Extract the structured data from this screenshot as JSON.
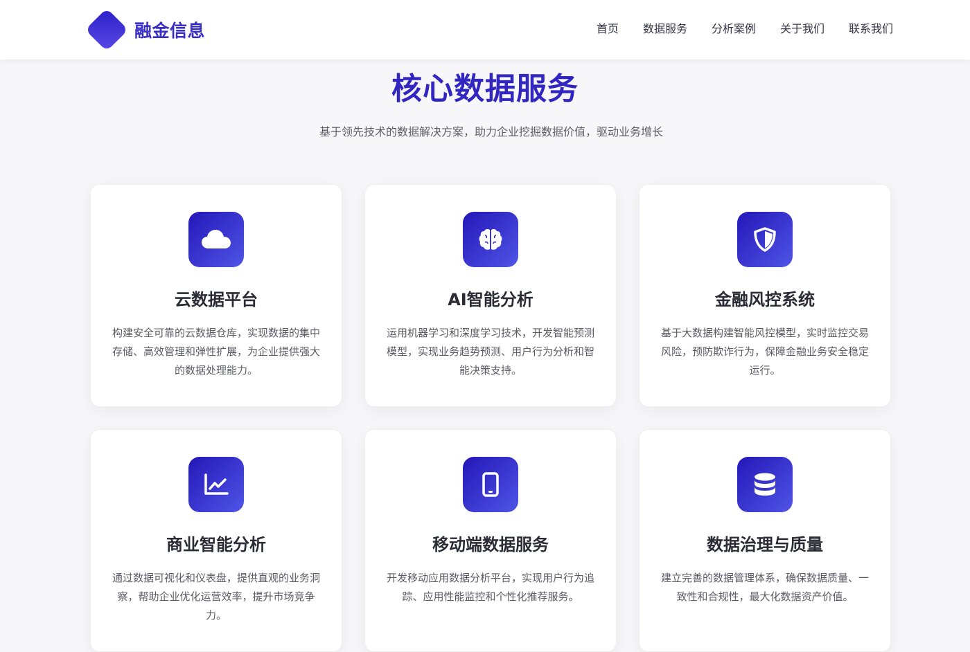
{
  "brand": {
    "name": "融金信息"
  },
  "nav": [
    {
      "label": "首页"
    },
    {
      "label": "数据服务"
    },
    {
      "label": "分析案例"
    },
    {
      "label": "关于我们"
    },
    {
      "label": "联系我们"
    }
  ],
  "section": {
    "title": "核心数据服务",
    "subtitle": "基于领先技术的数据解决方案，助力企业挖掘数据价值，驱动业务增长"
  },
  "services": [
    {
      "icon": "cloud-icon",
      "title": "云数据平台",
      "desc": "构建安全可靠的云数据仓库，实现数据的集中存储、高效管理和弹性扩展，为企业提供强大的数据处理能力。"
    },
    {
      "icon": "brain-icon",
      "title": "AI智能分析",
      "desc": "运用机器学习和深度学习技术，开发智能预测模型，实现业务趋势预测、用户行为分析和智能决策支持。"
    },
    {
      "icon": "shield-icon",
      "title": "金融风控系统",
      "desc": "基于大数据构建智能风控模型，实时监控交易风险，预防欺诈行为，保障金融业务安全稳定运行。"
    },
    {
      "icon": "chart-line-icon",
      "title": "商业智能分析",
      "desc": "通过数据可视化和仪表盘，提供直观的业务洞察，帮助企业优化运营效率，提升市场竞争力。"
    },
    {
      "icon": "mobile-icon",
      "title": "移动端数据服务",
      "desc": "开发移动应用数据分析平台，实现用户行为追踪、应用性能监控和个性化推荐服务。"
    },
    {
      "icon": "database-icon",
      "title": "数据治理与质量",
      "desc": "建立完善的数据管理体系，确保数据质量、一致性和合规性，最大化数据资产价值。"
    }
  ],
  "colors": {
    "accent": "#3226c1",
    "icon_gradient_start": "#2417b8",
    "icon_gradient_end": "#4f55e6"
  }
}
